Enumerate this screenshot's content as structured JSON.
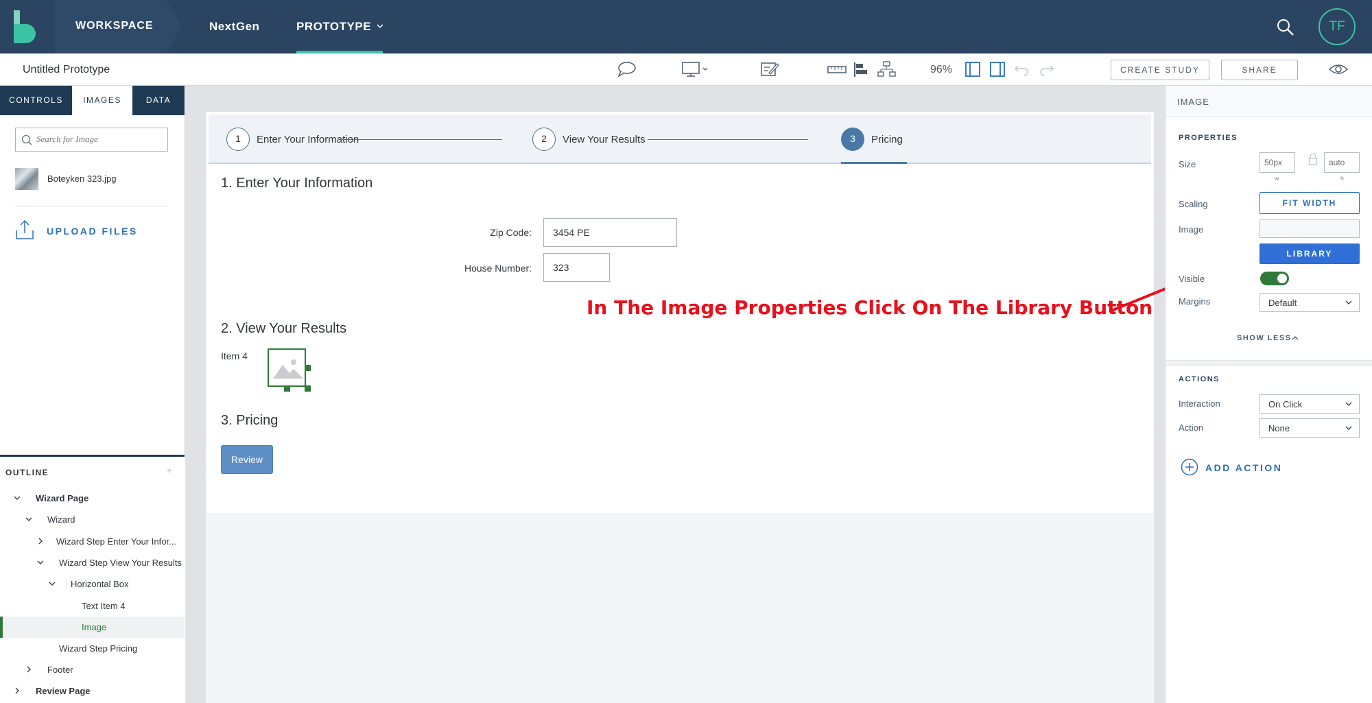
{
  "topnav": {
    "workspace_label": "WORKSPACE",
    "nextgen_label": "NextGen",
    "prototype_label": "PROTOTYPE",
    "avatar_initials": "TF",
    "bg_color": "#2b4461",
    "accent_color": "#3cc2a4"
  },
  "toolbar": {
    "title": "Untitled Prototype",
    "zoom": "96%",
    "create_study_label": "CREATE STUDY",
    "share_label": "SHARE",
    "icons": [
      "comment-icon",
      "desktop-device-icon",
      "edit-icon",
      "ruler-icon",
      "align-icon",
      "hierarchy-icon",
      "left-panel-icon",
      "right-panel-icon",
      "undo-icon",
      "redo-icon",
      "preview-eye-icon"
    ]
  },
  "left_panel": {
    "tabs": [
      "CONTROLS",
      "IMAGES",
      "DATA"
    ],
    "active_tab": "IMAGES",
    "search_placeholder": "Search for Image",
    "files": [
      {
        "name": "Boteyken 323.jpg"
      }
    ],
    "upload_label": "UPLOAD FILES"
  },
  "outline": {
    "title": "OUTLINE",
    "items": [
      {
        "label": "Wizard Page",
        "bold": true,
        "chevron": "down"
      },
      {
        "label": "Wizard",
        "bold": false,
        "chevron": "down"
      },
      {
        "label": "Wizard Step Enter Your Infor...",
        "bold": false,
        "chevron": "right"
      },
      {
        "label": "Wizard Step View Your Results",
        "bold": false,
        "chevron": "down"
      },
      {
        "label": "Horizontal Box",
        "bold": false,
        "chevron": "down"
      },
      {
        "label": "Text Item 4",
        "bold": false,
        "chevron": "none"
      },
      {
        "label": "Image",
        "bold": false,
        "chevron": "none",
        "selected": true
      },
      {
        "label": "Wizard Step Pricing",
        "bold": false,
        "chevron": "none"
      },
      {
        "label": "Footer",
        "bold": false,
        "chevron": "right"
      },
      {
        "label": "Review Page",
        "bold": true,
        "chevron": "right"
      }
    ]
  },
  "wizard": {
    "steps": [
      {
        "number": "1",
        "label": "Enter Your Information",
        "active": false
      },
      {
        "number": "2",
        "label": "View Your Results",
        "active": false
      },
      {
        "number": "3",
        "label": "Pricing",
        "active": true
      }
    ],
    "section1_title": "1. Enter Your Information",
    "zip_label": "Zip Code:",
    "zip_value": "3454 PE",
    "house_label": "House Number:",
    "house_value": "323",
    "section2_title": "2. View Your Results",
    "item4_label": "Item 4",
    "section3_title": "3. Pricing",
    "review_label": "Review"
  },
  "annotation": {
    "text": "In The Image Properties Click On The Library Button",
    "color": "#e8101c"
  },
  "right_panel": {
    "title": "IMAGE",
    "properties_label": "PROPERTIES",
    "size_label": "Size",
    "width_value": "50px",
    "width_sub": "w",
    "height_value": "auto",
    "height_sub": "h",
    "scaling_label": "Scaling",
    "fit_width_label": "FIT WIDTH",
    "image_label": "Image",
    "library_label": "LIBRARY",
    "visible_label": "Visible",
    "visible_on": true,
    "margins_label": "Margins",
    "margins_value": "Default",
    "show_less_label": "SHOW LESS",
    "actions_label": "ACTIONS",
    "interaction_label": "Interaction",
    "interaction_value": "On Click",
    "action_label": "Action",
    "action_value": "None",
    "add_action_label": "ADD ACTION"
  }
}
